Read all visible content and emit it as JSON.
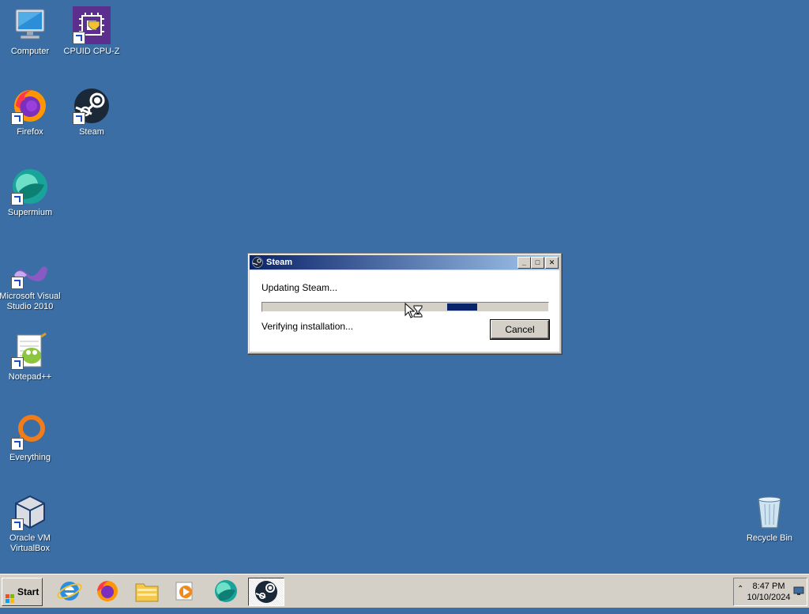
{
  "desktop": {
    "icons": [
      {
        "label": "Computer",
        "icon": "computer-icon"
      },
      {
        "label": "CPUID CPU-Z",
        "icon": "cpuz-icon"
      },
      {
        "label": "Firefox",
        "icon": "firefox-icon"
      },
      {
        "label": "Steam",
        "icon": "steam-icon"
      },
      {
        "label": "Supermium",
        "icon": "supermium-icon"
      },
      {
        "label": "Microsoft Visual Studio 2010",
        "icon": "visual-studio-icon"
      },
      {
        "label": "Notepad++",
        "icon": "notepadpp-icon"
      },
      {
        "label": "Everything",
        "icon": "everything-icon"
      },
      {
        "label": "Oracle VM VirtualBox",
        "icon": "virtualbox-icon"
      },
      {
        "label": "Recycle Bin",
        "icon": "recycle-bin-icon"
      }
    ],
    "background_color": "#3a6ea5"
  },
  "dialog": {
    "title": "Steam",
    "status_top": "Updating Steam...",
    "status_bottom": "Verifying installation...",
    "cancel_label": "Cancel",
    "progress_indeterminate": true
  },
  "taskbar": {
    "start_label": "Start",
    "pinned": [
      "internet-explorer-icon",
      "firefox-icon",
      "file-explorer-icon",
      "media-player-icon",
      "supermium-icon",
      "steam-icon"
    ],
    "active": "steam-icon",
    "clock_time": "8:47 PM",
    "clock_date": "10/10/2024"
  }
}
